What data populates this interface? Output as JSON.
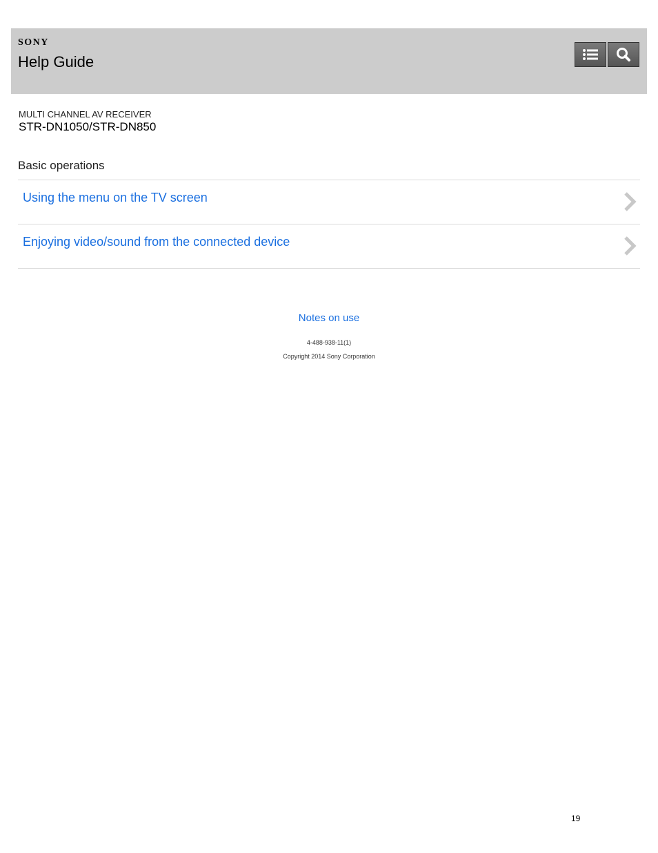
{
  "header": {
    "brand": "SONY",
    "title": "Help Guide",
    "buttons": [
      {
        "icon": "list-icon"
      },
      {
        "icon": "search-icon"
      }
    ]
  },
  "product": {
    "line": "MULTI CHANNEL AV RECEIVER",
    "model": "STR-DN1050/STR-DN850"
  },
  "section": {
    "title": "Basic operations",
    "items": [
      {
        "label": "Using the menu on the TV screen"
      },
      {
        "label": "Enjoying video/sound from the connected device"
      }
    ]
  },
  "footer": {
    "notes_link": "Notes on use",
    "doc_id": "4-488-938-11(1)",
    "copyright": "Copyright 2014 Sony Corporation"
  },
  "page_number": "19",
  "colors": {
    "header_bg": "#cccccc",
    "link": "#1a6fe0",
    "button_bg": "#5f5f5f",
    "chevron": "#c8c8c8"
  }
}
